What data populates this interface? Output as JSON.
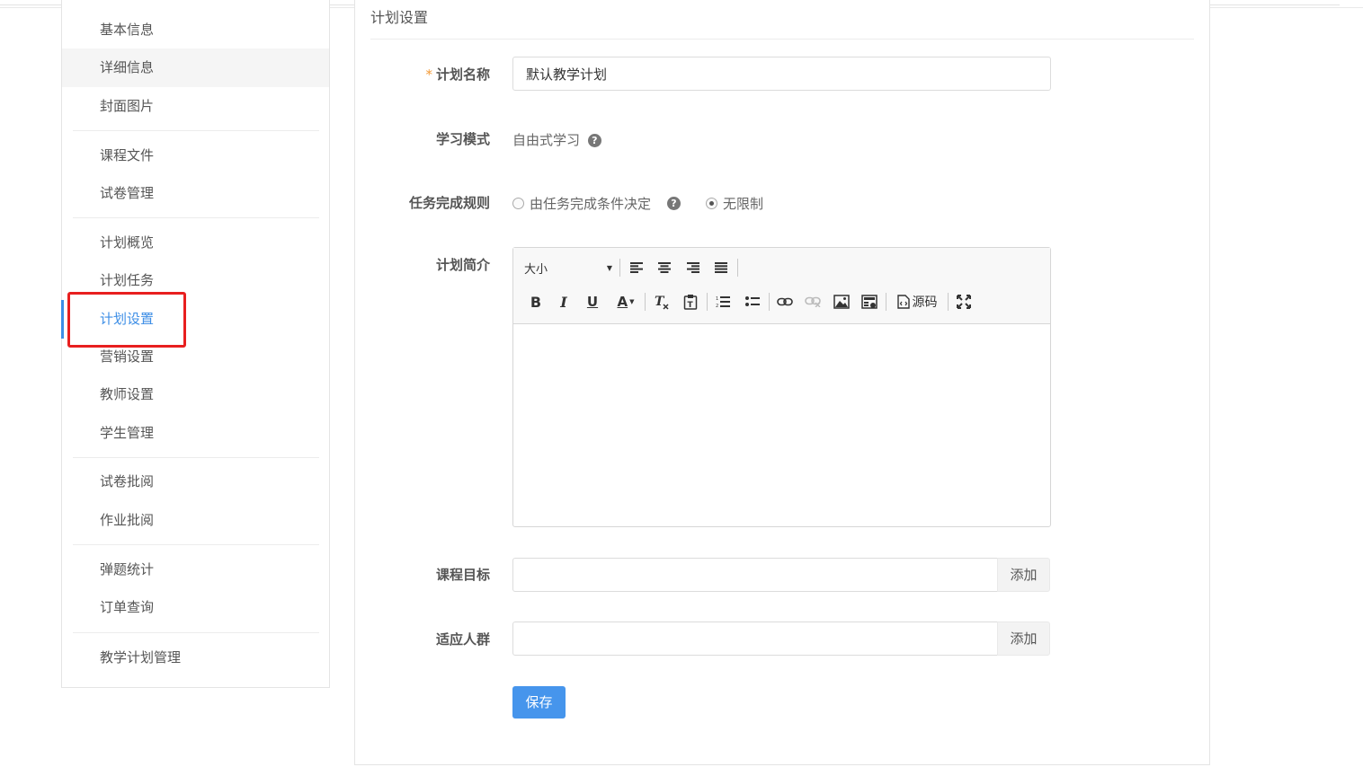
{
  "sidebar": {
    "items": [
      {
        "label": "基本信息"
      },
      {
        "label": "详细信息"
      },
      {
        "label": "封面图片"
      },
      {
        "label": "课程文件"
      },
      {
        "label": "试卷管理"
      },
      {
        "label": "计划概览"
      },
      {
        "label": "计划任务"
      },
      {
        "label": "计划设置"
      },
      {
        "label": "营销设置"
      },
      {
        "label": "教师设置"
      },
      {
        "label": "学生管理"
      },
      {
        "label": "试卷批阅"
      },
      {
        "label": "作业批阅"
      },
      {
        "label": "弹题统计"
      },
      {
        "label": "订单查询"
      },
      {
        "label": "教学计划管理"
      }
    ]
  },
  "panel": {
    "title": "计划设置"
  },
  "form": {
    "required_mark": "*",
    "plan_name": {
      "label": "计划名称",
      "value": "默认教学计划"
    },
    "learn_mode": {
      "label": "学习模式",
      "value": "自由式学习",
      "help": "?"
    },
    "task_rule": {
      "label": "任务完成规则",
      "options": [
        {
          "label": "由任务完成条件决定",
          "checked": false
        },
        {
          "label": "无限制",
          "checked": true
        }
      ],
      "help": "?"
    },
    "summary": {
      "label": "计划简介",
      "toolbar": {
        "size_label": "大小",
        "bold": "B",
        "italic": "I",
        "underline": "U",
        "font_color": "A",
        "source_label": "源码"
      }
    },
    "goals": {
      "label": "课程目标",
      "value": "",
      "add_label": "添加"
    },
    "audience": {
      "label": "适应人群",
      "value": "",
      "add_label": "添加"
    },
    "save_label": "保存"
  }
}
